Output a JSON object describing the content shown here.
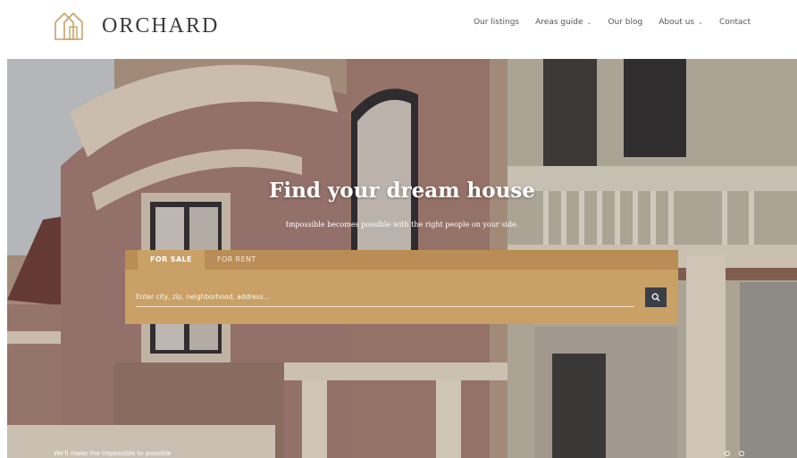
{
  "brand": {
    "name": "ORCHARD",
    "logo_icon": "house-outline-icon"
  },
  "nav": {
    "items": [
      {
        "label": "Our listings",
        "has_dropdown": false
      },
      {
        "label": "Areas guide",
        "has_dropdown": true
      },
      {
        "label": "Our blog",
        "has_dropdown": false
      },
      {
        "label": "About us",
        "has_dropdown": true
      },
      {
        "label": "Contact",
        "has_dropdown": false
      }
    ],
    "dropdown_glyph": "⌄"
  },
  "hero": {
    "title": "Find your dream house",
    "subtitle": "Impossible becomes possible with the right people on your side.",
    "footer_text": "We'll make the impossible to possible"
  },
  "search": {
    "tabs": [
      {
        "label": "FOR SALE",
        "active": true
      },
      {
        "label": "FOR RENT",
        "active": false
      }
    ],
    "placeholder": "Enter city, zip, neighborhood, address...",
    "value": "",
    "button_icon": "search-icon"
  },
  "slider": {
    "count": 2,
    "active_index": 0
  },
  "colors": {
    "accent": "#c9a066",
    "accent_dark": "#b98d55",
    "search_button": "#3a3f47",
    "text_dark": "#3a3a3a"
  }
}
